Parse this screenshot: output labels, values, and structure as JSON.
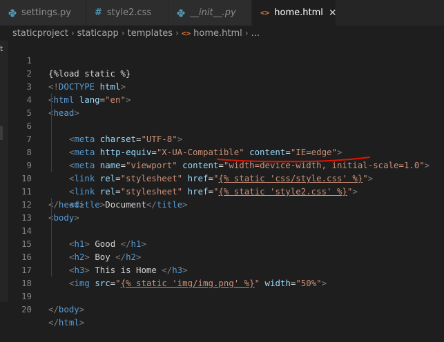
{
  "tabs": [
    {
      "label": "settings.py",
      "icon": "python-icon",
      "active": false
    },
    {
      "label": "style2.css",
      "icon": "hash-icon",
      "active": false
    },
    {
      "label": "__init__.py",
      "icon": "python-icon",
      "active": false
    },
    {
      "label": "home.html",
      "icon": "html-icon",
      "active": true,
      "close": "✕"
    }
  ],
  "breadcrumb": {
    "items": [
      "staticproject",
      "staticapp",
      "templates",
      "home.html",
      "..."
    ],
    "sep": "›",
    "file_icon": "<>"
  },
  "sliver": {
    "mark": "t"
  },
  "gutter": {
    "numbers": [
      "1",
      "2",
      "3",
      "4",
      "5",
      "6",
      "7",
      "8",
      "9",
      "10",
      "11",
      "12",
      "13",
      "14",
      "15",
      "16",
      "17",
      "18",
      "19",
      "20"
    ]
  },
  "code": {
    "l1": {
      "a": "{%load static %}"
    },
    "l2": {
      "a": "<!",
      "b": "DOCTYPE",
      "c": " html",
      "d": ">"
    },
    "l3": {
      "a": "<",
      "b": "html",
      "c": " lang",
      "d": "=",
      "e": "\"en\"",
      "f": ">"
    },
    "l4": {
      "a": "<",
      "b": "head",
      "c": ">"
    },
    "l5": {
      "a": "<",
      "b": "meta",
      "c": " charset",
      "d": "=",
      "e": "\"UTF-8\"",
      "f": ">"
    },
    "l6": {
      "a": "<",
      "b": "meta",
      "c": " http-equiv",
      "d": "=",
      "e": "\"X-UA-Compatible\"",
      "f": " content",
      "g": "=",
      "h": "\"IE=edge\"",
      "i": ">"
    },
    "l7": {
      "a": "<",
      "b": "meta",
      "c": " name",
      "d": "=",
      "e": "\"viewport\"",
      "f": " content",
      "g": "=",
      "h": "\"width=device-width, initial-scale=1.0\"",
      "i": ">"
    },
    "l8": {
      "a": "<",
      "b": "link",
      "c": " rel",
      "d": "=",
      "e": "\"stylesheet\"",
      "f": " href",
      "g": "=",
      "h": "\"",
      "i": "{% static 'css/style.css' %}",
      "j": "\"",
      "k": ">"
    },
    "l9": {
      "a": "<",
      "b": "link",
      "c": " rel",
      "d": "=",
      "e": "\"stylesheet\"",
      "f": " href",
      "g": "=",
      "h": "\"",
      "i": "{% static 'style2.css' %}",
      "j": "\"",
      "k": ">"
    },
    "l10": {
      "a": "<",
      "b": "title",
      "c": ">",
      "d": "Document",
      "e": "</",
      "f": "title",
      "g": ">"
    },
    "l11": {
      "a": "</",
      "b": "head",
      "c": ">"
    },
    "l12": {
      "a": "<",
      "b": "body",
      "c": ">"
    },
    "l13": {
      "a": "<",
      "b": "h1",
      "c": ">",
      "d": " Good ",
      "e": "</",
      "f": "h1",
      "g": ">"
    },
    "l14": {
      "a": "<",
      "b": "h2",
      "c": ">",
      "d": " Boy ",
      "e": "</",
      "f": "h2",
      "g": ">"
    },
    "l15": {
      "a": "<",
      "b": "h3",
      "c": ">",
      "d": " This is Home ",
      "e": "</",
      "f": "h3",
      "g": ">"
    },
    "l16": {
      "a": "<",
      "b": "img",
      "c": " src",
      "d": "=",
      "e": "\"",
      "f": "{% static 'img/img.png' %}",
      "g": "\"",
      "h": " width",
      "i": "=",
      "j": "\"50%\"",
      "k": ">"
    },
    "l19": {
      "a": "</",
      "b": "body",
      "c": ">"
    },
    "l20": {
      "a": "</",
      "b": "html",
      "c": ">"
    }
  },
  "colors": {
    "tag": "#569cd6",
    "attr": "#9cdcfe",
    "string": "#ce9178",
    "punct": "#808080",
    "text": "#d4d4d4",
    "annotation": "#e51400"
  }
}
